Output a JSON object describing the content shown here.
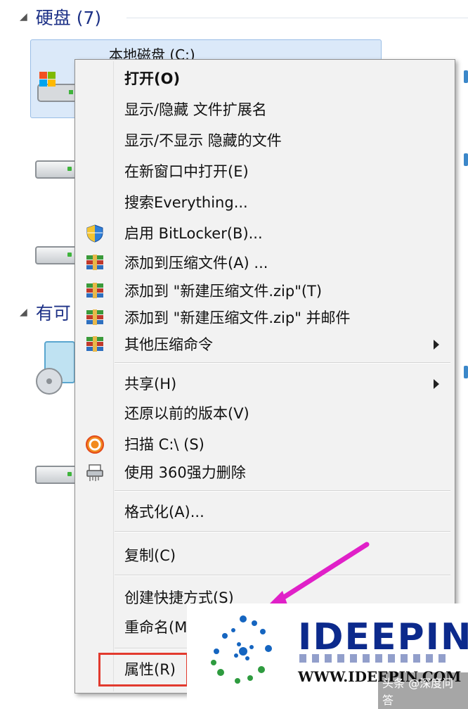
{
  "explorer": {
    "section_drives": "硬盘 (7)",
    "selected_drive": "本地磁盘 (C:)",
    "section_removable": "有可"
  },
  "menu": {
    "items": [
      {
        "label": "打开(O)",
        "bold": true,
        "icon": ""
      },
      {
        "label": "显示/隐藏 文件扩展名",
        "icon": ""
      },
      {
        "label": "显示/不显示 隐藏的文件",
        "icon": ""
      },
      {
        "label": "在新窗口中打开(E)",
        "icon": ""
      },
      {
        "label": "搜索Everything...",
        "icon": ""
      },
      {
        "label": "启用 BitLocker(B)...",
        "icon": "shield-icon"
      },
      {
        "label": "添加到压缩文件(A) ...",
        "icon": "winrar-icon"
      },
      {
        "label": "添加到 \"新建压缩文件.zip\"(T)",
        "icon": "winrar-icon"
      },
      {
        "label": "添加到 \"新建压缩文件.zip\" 并邮件",
        "icon": "winrar-icon"
      },
      {
        "label": "其他压缩命令",
        "icon": "winrar-icon",
        "submenu": true
      },
      {
        "label": "共享(H)",
        "icon": "",
        "submenu": true
      },
      {
        "label": "还原以前的版本(V)",
        "icon": ""
      },
      {
        "label": "扫描 C:\\ (S)",
        "icon": "360-scan-icon"
      },
      {
        "label": "使用 360强力删除",
        "icon": "shredder-icon"
      },
      {
        "label": "格式化(A)...",
        "icon": ""
      },
      {
        "label": "复制(C)",
        "icon": ""
      },
      {
        "label": "创建快捷方式(S)",
        "icon": ""
      },
      {
        "label": "重命名(M)",
        "icon": ""
      },
      {
        "label": "属性(R)",
        "icon": ""
      }
    ]
  },
  "watermark": {
    "brand": "IDEEPIN",
    "url": "WWW.IDEEPIN.COM",
    "credit": "头条 @深度问答"
  },
  "colors": {
    "accent": "#1e3287",
    "highlight": "#e23a2e",
    "arrow": "#e020c8"
  }
}
